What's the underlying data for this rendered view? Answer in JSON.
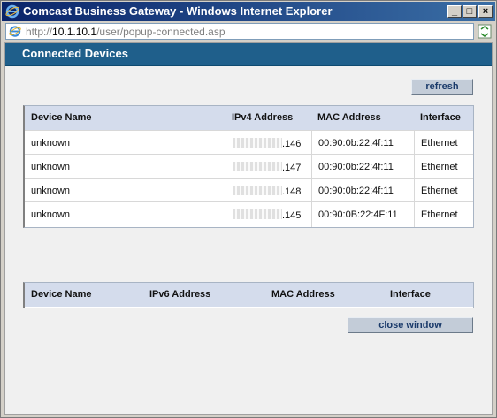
{
  "window": {
    "title": "Comcast Business Gateway - Windows Internet Explorer",
    "controls": {
      "minimize": "_",
      "maximize": "□",
      "close": "×"
    }
  },
  "address": {
    "prefix": "http://",
    "host": "10.1.10.1",
    "path": "/user/popup-connected.asp"
  },
  "page": {
    "title": "Connected Devices",
    "refresh_label": "refresh",
    "close_label": "close window"
  },
  "ipv4_table": {
    "headers": [
      "Device Name",
      "IPv4 Address",
      "MAC Address",
      "Interface"
    ],
    "rows": [
      {
        "name": "unknown",
        "ip_suffix": ".146",
        "mac": "00:90:0b:22:4f:11",
        "interface": "Ethernet"
      },
      {
        "name": "unknown",
        "ip_suffix": ".147",
        "mac": "00:90:0b:22:4f:11",
        "interface": "Ethernet"
      },
      {
        "name": "unknown",
        "ip_suffix": ".148",
        "mac": "00:90:0b:22:4f:11",
        "interface": "Ethernet"
      },
      {
        "name": "unknown",
        "ip_suffix": ".145",
        "mac": "00:90:0B:22:4F:11",
        "interface": "Ethernet"
      }
    ]
  },
  "ipv6_table": {
    "headers": [
      "Device Name",
      "IPv6 Address",
      "MAC Address",
      "Interface"
    ]
  }
}
